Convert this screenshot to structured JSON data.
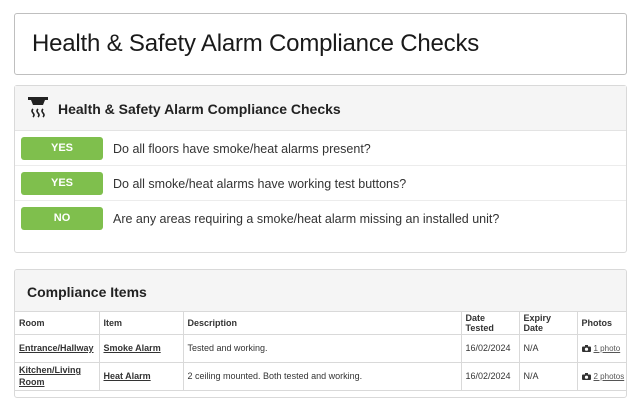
{
  "page": {
    "title": "Health & Safety Alarm Compliance Checks"
  },
  "checks": {
    "header_icon": "smoke-alarm-icon",
    "title": "Health & Safety Alarm Compliance Checks",
    "answer_color": "#7fbf4d",
    "items": [
      {
        "answer": "YES",
        "question": "Do all floors have smoke/heat alarms present?"
      },
      {
        "answer": "YES",
        "question": "Do all smoke/heat alarms have working test buttons?"
      },
      {
        "answer": "NO",
        "question": "Are any areas requiring a smoke/heat alarm missing an installed unit?"
      }
    ]
  },
  "compliance": {
    "title": "Compliance Items",
    "columns": [
      "Room",
      "Item",
      "Description",
      "Date Tested",
      "Expiry Date",
      "Photos"
    ],
    "rows": [
      {
        "room": "Entrance/Hallway",
        "item": "Smoke Alarm",
        "description": "Tested and working.",
        "date_tested": "16/02/2024",
        "expiry": "N/A",
        "photos": "1 photo"
      },
      {
        "room": "Kitchen/Living Room",
        "item": "Heat Alarm",
        "description": "2 ceiling mounted. Both tested and working.",
        "date_tested": "16/02/2024",
        "expiry": "N/A",
        "photos": "2 photos"
      }
    ]
  }
}
